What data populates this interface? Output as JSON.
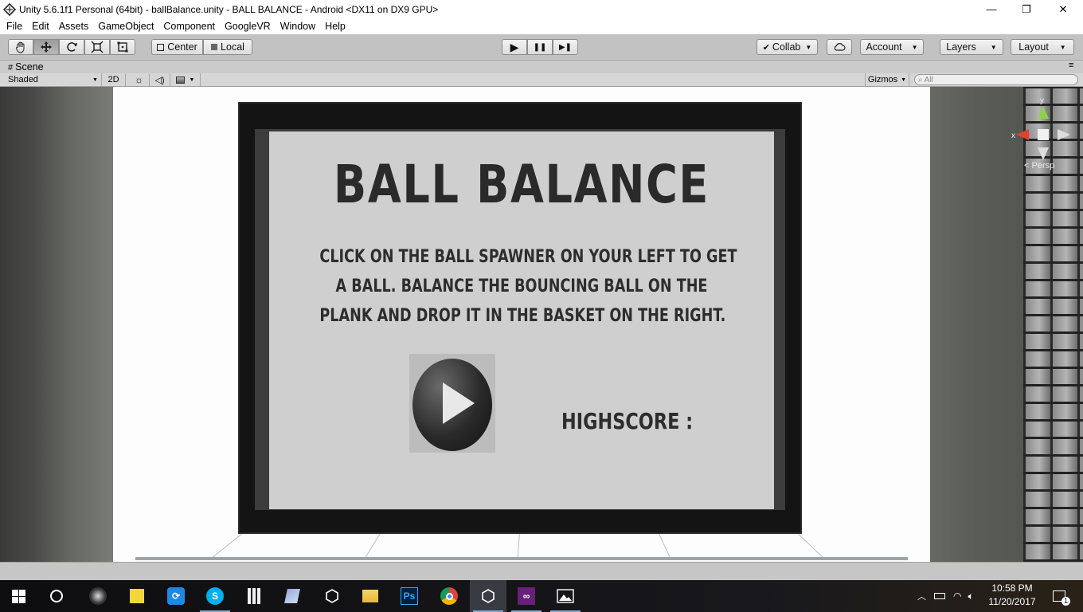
{
  "window": {
    "title": "Unity 5.6.1f1 Personal (64bit) - ballBalance.unity - BALL BALANCE - Android <DX11 on DX9 GPU>",
    "minimize": "—",
    "maximize": "❐",
    "close": "✕"
  },
  "menu": [
    "File",
    "Edit",
    "Assets",
    "GameObject",
    "Component",
    "GoogleVR",
    "Window",
    "Help"
  ],
  "toolbar": {
    "tools": [
      "hand-icon",
      "move-icon",
      "rotate-icon",
      "scale-icon",
      "rect-icon"
    ],
    "pivot": "Center",
    "space": "Local",
    "play": "▶",
    "pause": "❚❚",
    "step": "▶❚",
    "collab": "Collab",
    "account": "Account",
    "layers": "Layers",
    "layout": "Layout"
  },
  "scene": {
    "tab_label": "Scene",
    "shading": "Shaded",
    "mode_2d": "2D",
    "gizmos": "Gizmos",
    "search_placeholder": "All",
    "persp_label": "Persp",
    "axis_y": "y",
    "axis_x": "x"
  },
  "game_board": {
    "title": "BALL BALANCE",
    "instructions": [
      "CLICK ON THE BALL SPAWNER ON YOUR LEFT TO GET",
      "A BALL. BALANCE THE BOUNCING BALL ON THE",
      "PLANK AND DROP IT IN THE BASKET ON THE RIGHT."
    ],
    "highscore_label": "HIGHSCORE :"
  },
  "taskbar": {
    "ps_label": "Ps",
    "time": "10:58 PM",
    "date": "11/20/2017",
    "notifications": "1"
  },
  "colors": {
    "toolbar_bg": "#c2c2c2",
    "board_bg": "#cfcfcf",
    "taskbar_bg": "#0e0e10",
    "gizmo_y": "#8fd14f",
    "gizmo_x": "#e0422f"
  }
}
